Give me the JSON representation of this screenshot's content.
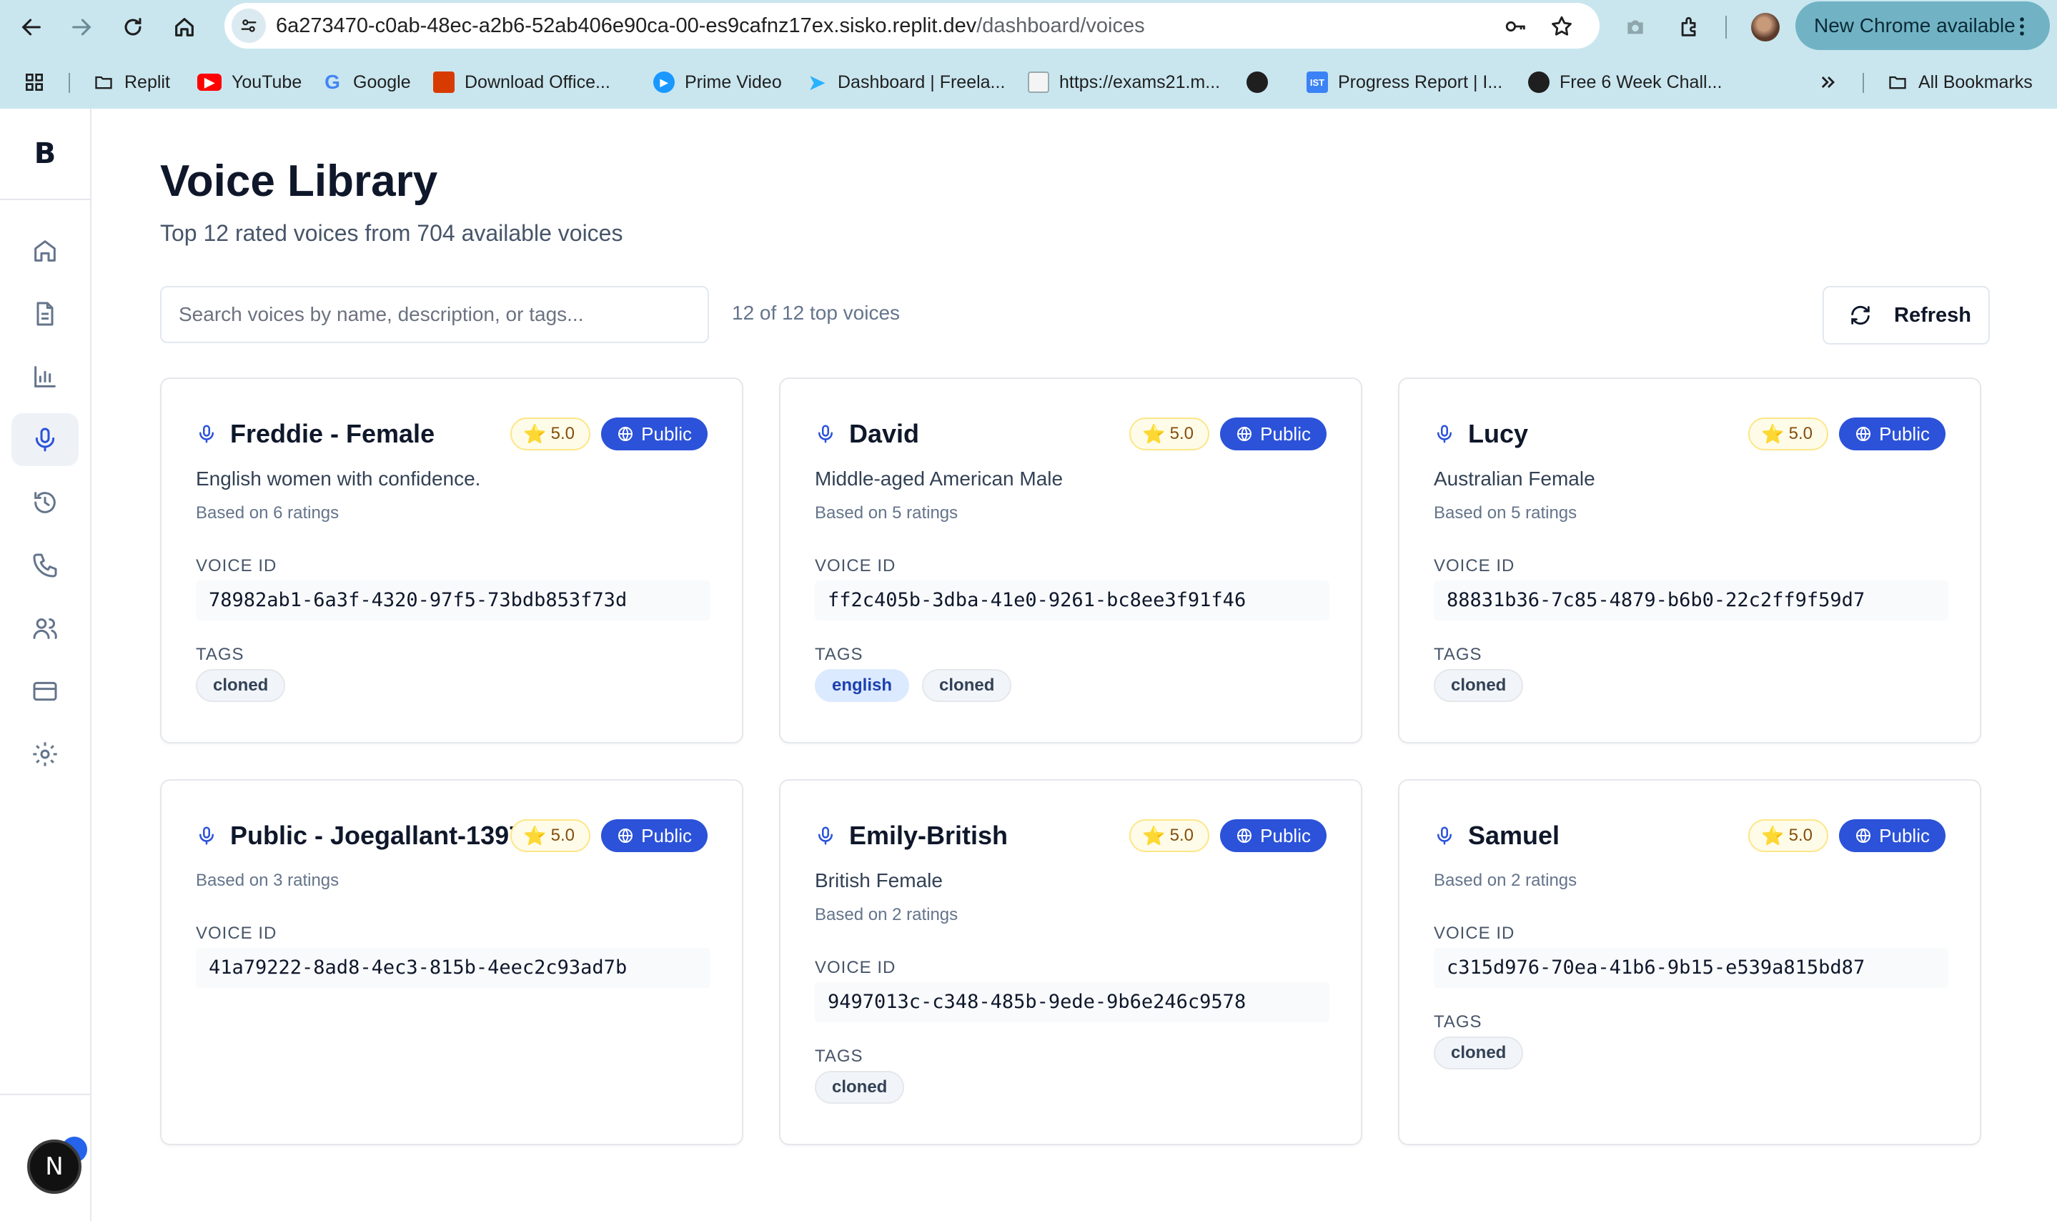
{
  "browser": {
    "url_host": "6a273470-c0ab-48ec-a2b6-52ab406e90ca-00-es9cafnz17ex.sisko.replit.dev",
    "url_path": "/dashboard/voices",
    "update_label": "New Chrome available",
    "bookmarks": [
      {
        "label": "Replit",
        "icon": "folder-icon"
      },
      {
        "label": "YouTube",
        "icon": "youtube-icon"
      },
      {
        "label": "Google",
        "icon": "google-icon"
      },
      {
        "label": "Download Office...",
        "icon": "office-icon"
      },
      {
        "label": "Prime Video",
        "icon": "prime-video-icon"
      },
      {
        "label": "Dashboard | Freela...",
        "icon": "freelancer-icon"
      },
      {
        "label": "https://exams21.m...",
        "icon": "document-icon"
      },
      {
        "label": "",
        "icon": "globe-icon"
      },
      {
        "label": "Progress Report | I...",
        "icon": "ist-icon"
      },
      {
        "label": "Free 6 Week Chall...",
        "icon": "globe-icon"
      }
    ],
    "all_bookmarks_label": "All Bookmarks",
    "ist_icon_text": "IST"
  },
  "app": {
    "brand_letter": "B",
    "user_initial": "N",
    "sidebar": [
      {
        "name": "home",
        "active": false
      },
      {
        "name": "documents",
        "active": false
      },
      {
        "name": "analytics",
        "active": false
      },
      {
        "name": "voices",
        "active": true
      },
      {
        "name": "history",
        "active": false
      },
      {
        "name": "calls",
        "active": false
      },
      {
        "name": "users",
        "active": false
      },
      {
        "name": "billing",
        "active": false
      },
      {
        "name": "settings",
        "active": false
      }
    ]
  },
  "page": {
    "title": "Voice Library",
    "subtitle": "Top 12 rated voices from 704 available voices",
    "search_placeholder": "Search voices by name, description, or tags...",
    "count_text": "12 of 12 top voices",
    "refresh_label": "Refresh",
    "voice_id_label": "VOICE ID",
    "tags_label": "TAGS"
  },
  "voices": [
    {
      "name": "Freddie - Female",
      "rating": "5.0",
      "visibility": "Public",
      "description": "English women with confidence.",
      "ratings_text": "Based on 6 ratings",
      "voice_id": "78982ab1-6a3f-4320-97f5-73bdb853f73d",
      "tags": [
        "cloned"
      ]
    },
    {
      "name": "David",
      "rating": "5.0",
      "visibility": "Public",
      "description": "Middle-aged American Male",
      "ratings_text": "Based on 5 ratings",
      "voice_id": "ff2c405b-3dba-41e0-9261-bc8ee3f91f46",
      "tags": [
        "english",
        "cloned"
      ]
    },
    {
      "name": "Lucy",
      "rating": "5.0",
      "visibility": "Public",
      "description": "Australian Female",
      "ratings_text": "Based on 5 ratings",
      "voice_id": "88831b36-7c85-4879-b6b0-22c2ff9f59d7",
      "tags": [
        "cloned"
      ]
    },
    {
      "name": "Public - Joegallant-1397",
      "rating": "5.0",
      "visibility": "Public",
      "description": "",
      "ratings_text": "Based on 3 ratings",
      "voice_id": "41a79222-8ad8-4ec3-815b-4eec2c93ad7b",
      "tags": []
    },
    {
      "name": "Emily-British",
      "rating": "5.0",
      "visibility": "Public",
      "description": "British Female",
      "ratings_text": "Based on 2 ratings",
      "voice_id": "9497013c-c348-485b-9ede-9b6e246c9578",
      "tags": [
        "cloned"
      ]
    },
    {
      "name": "Samuel",
      "rating": "5.0",
      "visibility": "Public",
      "description": "",
      "ratings_text": "Based on 2 ratings",
      "voice_id": "c315d976-70ea-41b6-9b15-e539a815bd87",
      "tags": [
        "cloned"
      ]
    }
  ],
  "colors": {
    "chrome_bg": "#c9e6ef",
    "accent_blue": "#2b52d9",
    "rating_bg": "#fefce8",
    "tag_blue_bg": "#dbeafe"
  }
}
